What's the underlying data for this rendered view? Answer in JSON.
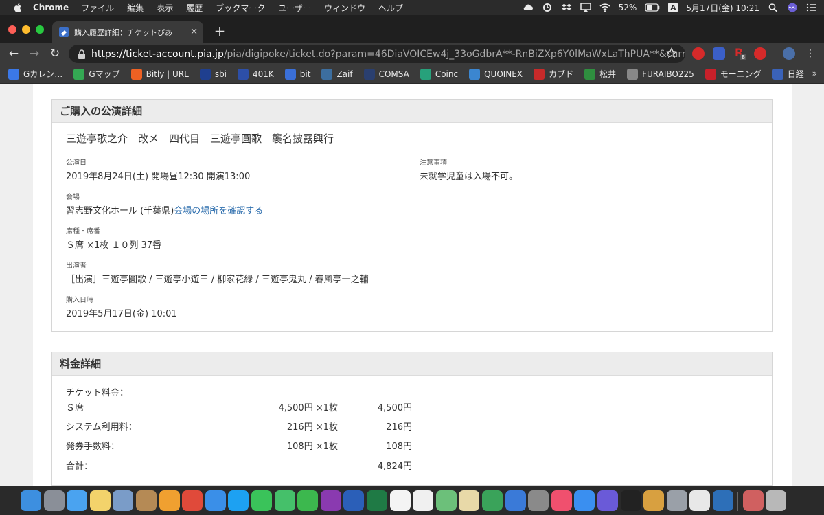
{
  "menubar": {
    "app_name": "Chrome",
    "menus": [
      "ファイル",
      "編集",
      "表示",
      "履歴",
      "ブックマーク",
      "ユーザー",
      "ウィンドウ",
      "ヘルプ"
    ],
    "battery": "52%",
    "input_mode": "A",
    "datetime": "5月17日(金)  10:21"
  },
  "browser": {
    "tab_title": "購入履歴詳細：チケットぴあ",
    "url_host": "https://ticket-account.pia.jp",
    "url_rest": "/pia/digipoke/ticket.do?param=46DiaVOICEw4j_33oGdbrA**-RnBiZXp6Y0lMaWxLaThPUA**&currPage=...",
    "bookmarks": [
      {
        "label": "Gカレン…",
        "icon": "calendar-icon",
        "color": "#3b78e7"
      },
      {
        "label": "Gマップ",
        "icon": "maps-icon",
        "color": "#34a853"
      },
      {
        "label": "Bitly | URL",
        "icon": "bitly-icon",
        "color": "#ee6123"
      },
      {
        "label": "sbi",
        "icon": "sbi-icon",
        "color": "#1f3f8f"
      },
      {
        "label": "401K",
        "icon": "401k-icon",
        "color": "#2d4fa8"
      },
      {
        "label": "bit",
        "icon": "bitflyer-icon",
        "color": "#3a6fd8"
      },
      {
        "label": "Zaif",
        "icon": "zaif-icon",
        "color": "#3c6e9f"
      },
      {
        "label": "COMSA",
        "icon": "comsa-icon",
        "color": "#2a3f6f"
      },
      {
        "label": "Coinc",
        "icon": "coincheck-icon",
        "color": "#27a17b"
      },
      {
        "label": "QUOINEX",
        "icon": "quoinex-icon",
        "color": "#3b86d0"
      },
      {
        "label": "カブド",
        "icon": "kabutan-icon",
        "color": "#c72a2a"
      },
      {
        "label": "松井",
        "icon": "matsui-icon",
        "color": "#2f8f3f"
      },
      {
        "label": "FURAIBO225",
        "icon": "globe-icon",
        "color": "#888888"
      },
      {
        "label": "モーニング",
        "icon": "morningstar-icon",
        "color": "#c8202a"
      },
      {
        "label": "日経",
        "icon": "nikkei-icon",
        "color": "#3a62b8"
      }
    ],
    "bookmarks_more": "»",
    "extension_badge": "8"
  },
  "performance": {
    "section_title": "ご購入の公演詳細",
    "show_title": "三遊亭歌之介　改メ　四代目　三遊亭圓歌　襲名披露興行",
    "date_label": "公演日",
    "date_value": "2019年8月24日(土) 開場昼12:30 開演13:00",
    "notes_label": "注意事項",
    "notes_value": "未就学児童は入場不可。",
    "venue_label": "会場",
    "venue_value": "習志野文化ホール (千葉県)",
    "venue_link": "会場の場所を確認する",
    "seat_label": "席種・席番",
    "seat_value": "Ｓ席 ×1枚 １０列 37番",
    "cast_label": "出演者",
    "cast_value": "［出演］三遊亭圓歌 / 三遊亭小遊三 / 柳家花緑 / 三遊亭鬼丸 / 春風亭一之輔",
    "purchase_label": "購入日時",
    "purchase_value": "2019年5月17日(金) 10:01"
  },
  "pricing": {
    "section_title": "料金詳細",
    "caption": "チケット料金：",
    "rows": [
      {
        "label": "Ｓ席",
        "unit": "4,500円 ×1枚",
        "total": "4,500円"
      },
      {
        "label": "システム利用料：",
        "unit": "216円 ×1枚",
        "total": "216円"
      },
      {
        "label": "発券手数料：",
        "unit": "108円 ×1枚",
        "total": "108円"
      }
    ],
    "sum_label": "合計：",
    "sum_value": "4,824円"
  },
  "dock": {
    "apps": [
      {
        "name": "finder-icon",
        "color": "#3d8fe0"
      },
      {
        "name": "launchpad-icon",
        "color": "#8a8f98"
      },
      {
        "name": "icloud-icon",
        "color": "#4aa3f0"
      },
      {
        "name": "notes-icon",
        "color": "#f3d36b"
      },
      {
        "name": "preview-icon",
        "color": "#7a9cc8"
      },
      {
        "name": "contacts-icon",
        "color": "#b58a55"
      },
      {
        "name": "photos-icon",
        "color": "#f0a030"
      },
      {
        "name": "chrome-icon",
        "color": "#e04a3a"
      },
      {
        "name": "safari-icon",
        "color": "#3a8fe8"
      },
      {
        "name": "twitter-icon",
        "color": "#1da1f2"
      },
      {
        "name": "line-icon",
        "color": "#3ac35a"
      },
      {
        "name": "messages-icon",
        "color": "#45c06a"
      },
      {
        "name": "facetime-icon",
        "color": "#3cb84e"
      },
      {
        "name": "onenote-icon",
        "color": "#8a3ab0"
      },
      {
        "name": "word-icon",
        "color": "#2b5fb8"
      },
      {
        "name": "excel-icon",
        "color": "#1f7a45"
      },
      {
        "name": "calendar-icon",
        "color": "#f4f4f4"
      },
      {
        "name": "reminders-icon",
        "color": "#f0f0f0"
      },
      {
        "name": "maps-icon",
        "color": "#6cc07a"
      },
      {
        "name": "textedit-icon",
        "color": "#e8d9a8"
      },
      {
        "name": "numbers-icon",
        "color": "#3aa35a"
      },
      {
        "name": "keynote-icon",
        "color": "#3a7ad8"
      },
      {
        "name": "system-preferences-icon",
        "color": "#8a8a8a"
      },
      {
        "name": "music-icon",
        "color": "#f0506e"
      },
      {
        "name": "app-store-icon",
        "color": "#3a8ff0"
      },
      {
        "name": "siri-icon",
        "color": "#6a5ad8"
      },
      {
        "name": "kindle-icon",
        "color": "#222222"
      },
      {
        "name": "clock-widget-icon",
        "color": "#d8a040"
      },
      {
        "name": "screenshot-icon",
        "color": "#9aa0a8"
      },
      {
        "name": "pages-icon",
        "color": "#e8e8e8"
      },
      {
        "name": "quicktime-icon",
        "color": "#2d6fb8"
      },
      {
        "name": "downloads-icon",
        "color": "#d06060"
      },
      {
        "name": "trash-icon",
        "color": "#b8b8b8"
      }
    ]
  },
  "colors": {
    "link": "#2f6fae",
    "panel_header": "#ececec",
    "page_background": "#efefef"
  }
}
